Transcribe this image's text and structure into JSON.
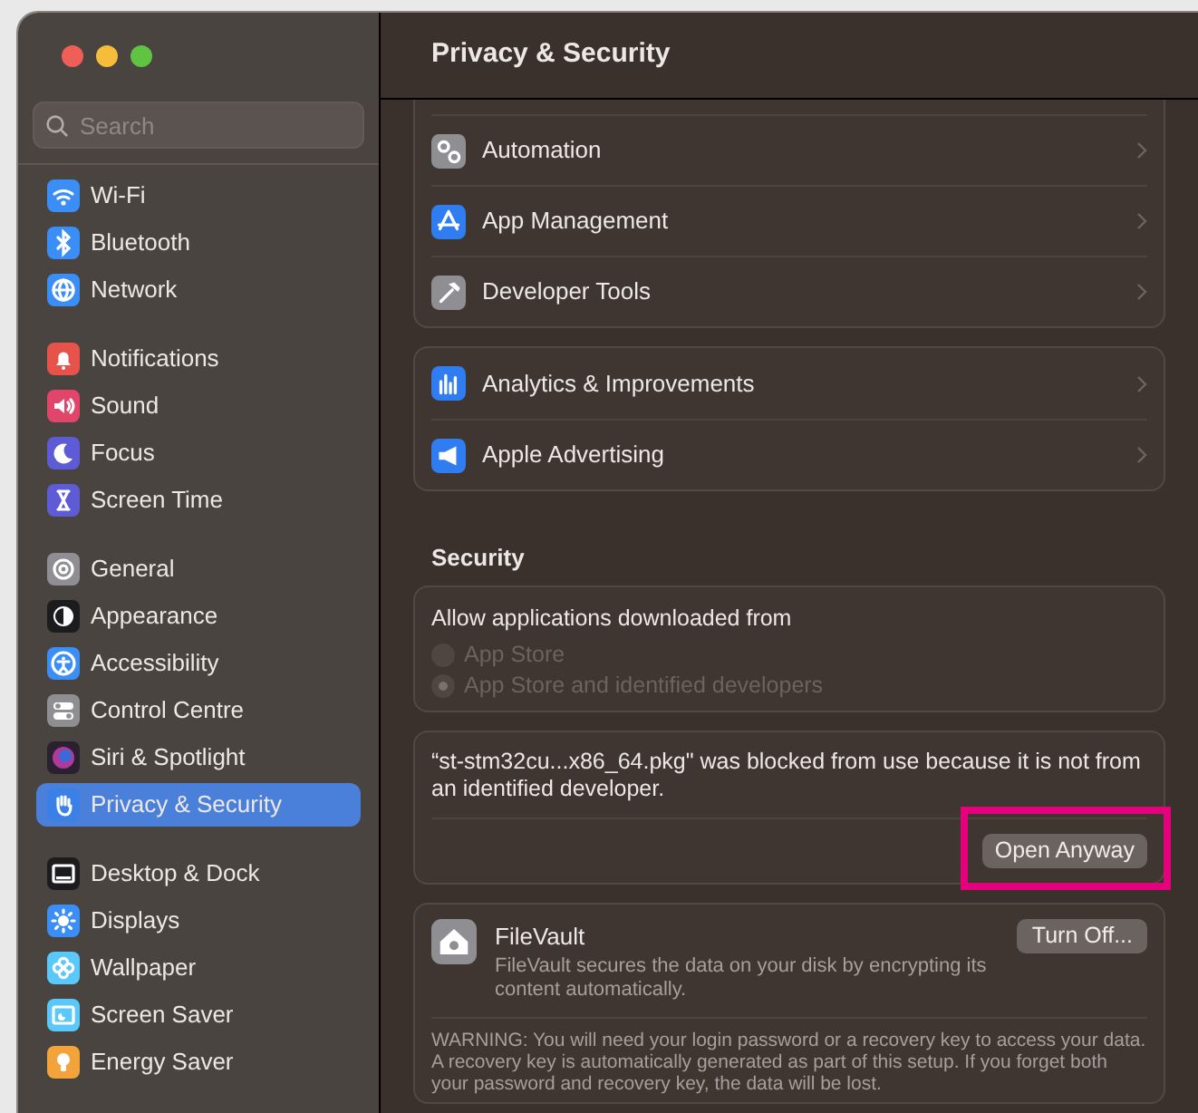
{
  "sidebar": {
    "search": {
      "placeholder": "Search"
    },
    "groups": [
      {
        "items": [
          {
            "label": "Wi-Fi",
            "selected": false
          },
          {
            "label": "Bluetooth",
            "selected": false
          },
          {
            "label": "Network",
            "selected": false
          }
        ]
      },
      {
        "items": [
          {
            "label": "Notifications",
            "selected": false
          },
          {
            "label": "Sound",
            "selected": false
          },
          {
            "label": "Focus",
            "selected": false
          },
          {
            "label": "Screen Time",
            "selected": false
          }
        ]
      },
      {
        "items": [
          {
            "label": "General",
            "selected": false
          },
          {
            "label": "Appearance",
            "selected": false
          },
          {
            "label": "Accessibility",
            "selected": false
          },
          {
            "label": "Control Centre",
            "selected": false
          },
          {
            "label": "Siri & Spotlight",
            "selected": false
          },
          {
            "label": "Privacy & Security",
            "selected": true
          }
        ]
      },
      {
        "items": [
          {
            "label": "Desktop & Dock",
            "selected": false
          },
          {
            "label": "Displays",
            "selected": false
          },
          {
            "label": "Wallpaper",
            "selected": false
          },
          {
            "label": "Screen Saver",
            "selected": false
          },
          {
            "label": "Energy Saver",
            "selected": false
          }
        ]
      }
    ]
  },
  "main": {
    "title": "Privacy & Security",
    "lists": [
      {
        "items": [
          {
            "label": "Automation"
          },
          {
            "label": "App Management"
          },
          {
            "label": "Developer Tools"
          }
        ]
      },
      {
        "items": [
          {
            "label": "Analytics & Improvements"
          },
          {
            "label": "Apple Advertising"
          }
        ]
      }
    ],
    "security": {
      "heading": "Security",
      "allow": {
        "label": "Allow applications downloaded from",
        "disabled": true,
        "options": [
          {
            "label": "App Store",
            "selected": false
          },
          {
            "label": "App Store and identified developers",
            "selected": true
          }
        ]
      },
      "blocked": {
        "message": "“st-stm32cu...x86_64.pkg\" was blocked from use because it is not from an identified developer.",
        "button": {
          "label": "Open Anyway",
          "highlighted": true
        }
      },
      "filevault": {
        "title": "FileVault",
        "description": "FileVault secures the data on your disk by encrypting its content automatically.",
        "button": "Turn Off...",
        "warning": "WARNING: You will need your login password or a recovery key to access your data. A recovery key is automatically generated as part of this setup. If you forget both your password and recovery key, the data will be lost."
      }
    }
  }
}
